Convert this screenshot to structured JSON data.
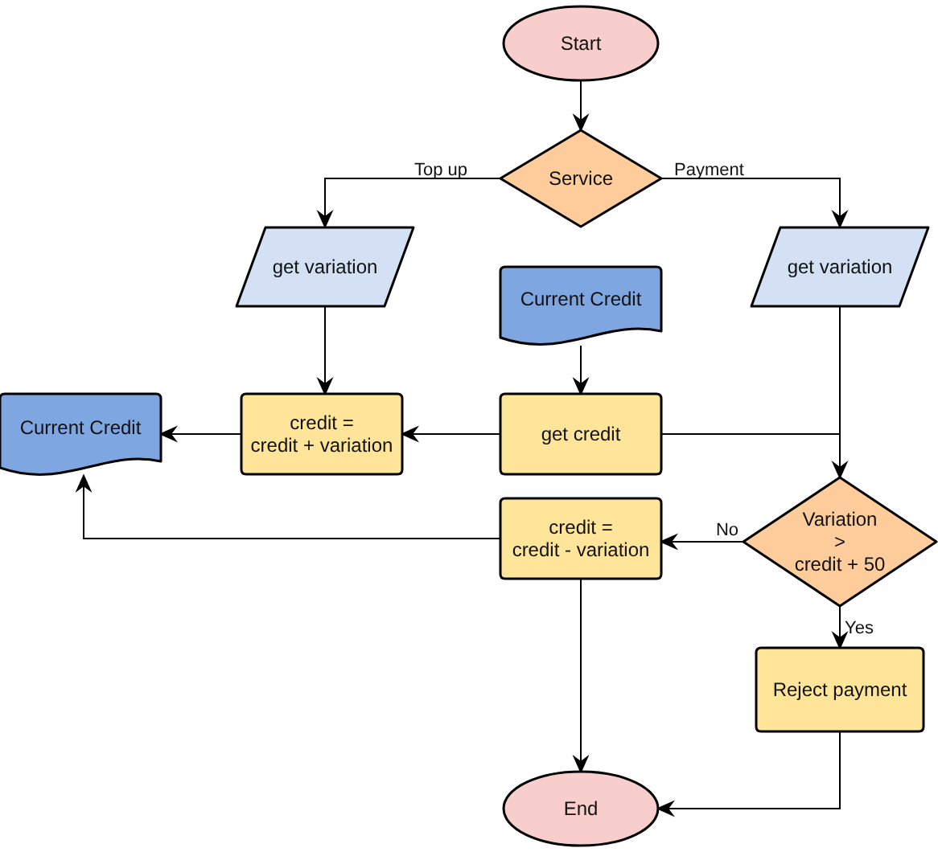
{
  "diagram": {
    "nodes": [
      {
        "kind": "terminal",
        "lines": [
          "Start"
        ]
      },
      {
        "kind": "decision",
        "lines": [
          "Service"
        ]
      },
      {
        "kind": "io",
        "lines": [
          "get variation"
        ]
      },
      {
        "kind": "document",
        "lines": [
          "Current Credit"
        ]
      },
      {
        "kind": "io",
        "lines": [
          "get variation"
        ]
      },
      {
        "kind": "document",
        "lines": [
          "Current Credit"
        ]
      },
      {
        "kind": "process",
        "lines": [
          "credit =",
          "credit + variation"
        ]
      },
      {
        "kind": "process",
        "lines": [
          "get credit"
        ]
      },
      {
        "kind": "process",
        "lines": [
          "credit =",
          "credit - variation"
        ]
      },
      {
        "kind": "decision",
        "lines": [
          "Variation",
          ">",
          "credit + 50"
        ]
      },
      {
        "kind": "process",
        "lines": [
          "Reject payment"
        ]
      },
      {
        "kind": "terminal",
        "lines": [
          "End"
        ]
      }
    ],
    "edge_labels": [
      "Top up",
      "Payment",
      "No",
      "Yes"
    ]
  }
}
